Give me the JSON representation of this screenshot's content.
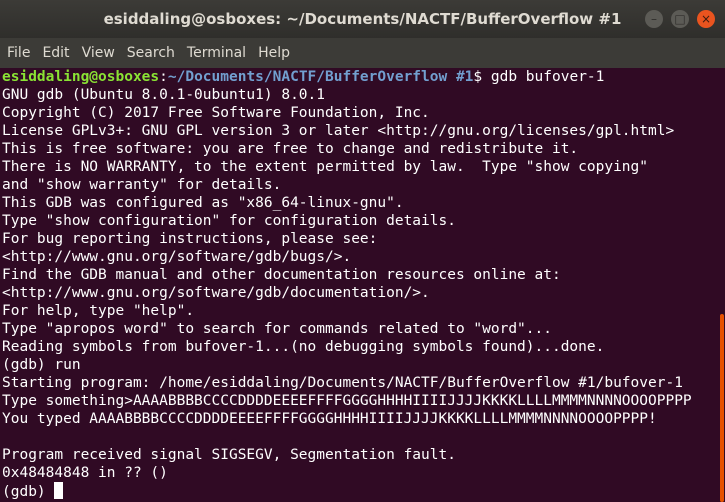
{
  "window": {
    "title": "esiddaling@osboxes: ~/Documents/NACTF/BufferOverflow #1",
    "buttons": {
      "minimize": "–",
      "maximize": "□",
      "close": "×"
    }
  },
  "menu": [
    "File",
    "Edit",
    "View",
    "Search",
    "Terminal",
    "Help"
  ],
  "terminal": {
    "prompt_user": "esiddaling@osboxes",
    "prompt_sep": ":",
    "prompt_path": "~/Documents/NACTF/BufferOverflow #1",
    "prompt_symbol": "$ ",
    "command": "gdb bufover-1",
    "output": [
      "GNU gdb (Ubuntu 8.0.1-0ubuntu1) 8.0.1",
      "Copyright (C) 2017 Free Software Foundation, Inc.",
      "License GPLv3+: GNU GPL version 3 or later <http://gnu.org/licenses/gpl.html>",
      "This is free software: you are free to change and redistribute it.",
      "There is NO WARRANTY, to the extent permitted by law.  Type \"show copying\"",
      "and \"show warranty\" for details.",
      "This GDB was configured as \"x86_64-linux-gnu\".",
      "Type \"show configuration\" for configuration details.",
      "For bug reporting instructions, please see:",
      "<http://www.gnu.org/software/gdb/bugs/>.",
      "Find the GDB manual and other documentation resources online at:",
      "<http://www.gnu.org/software/gdb/documentation/>.",
      "For help, type \"help\".",
      "Type \"apropos word\" to search for commands related to \"word\"...",
      "Reading symbols from bufover-1...(no debugging symbols found)...done.",
      "(gdb) run",
      "Starting program: /home/esiddaling/Documents/NACTF/BufferOverflow #1/bufover-1",
      "Type something>AAAABBBBCCCCDDDDEEEEFFFFGGGGHHHHIIIIJJJJKKKKLLLLMMMMNNNNOOOOPPPP",
      "You typed AAAABBBBCCCCDDDDEEEEFFFFGGGGHHHHIIIIJJJJKKKKLLLLMMMMNNNNOOOOPPPP!",
      "",
      "Program received signal SIGSEGV, Segmentation fault.",
      "0x48484848 in ?? ()"
    ],
    "current_prompt": "(gdb) "
  }
}
